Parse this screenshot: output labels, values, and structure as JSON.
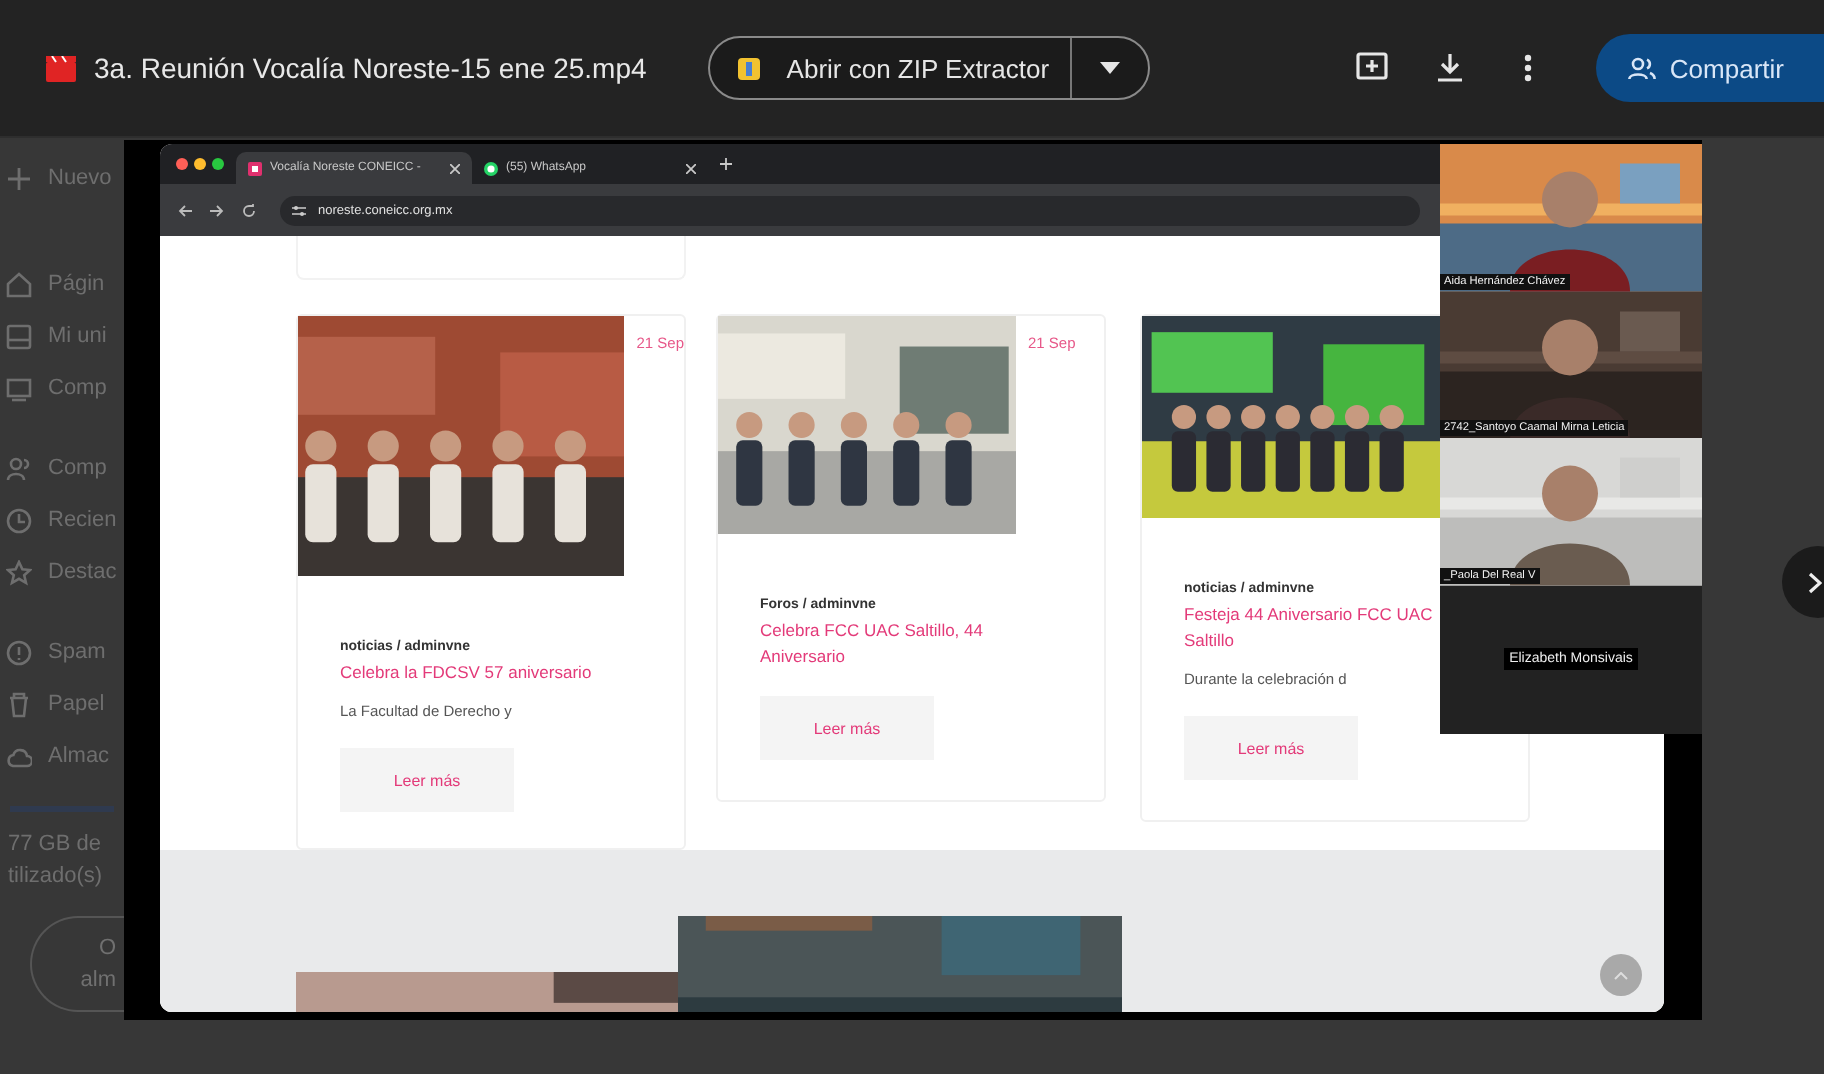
{
  "viewer": {
    "file_title": "3a. Reunión Vocalía Noreste-15 ene 25.mp4",
    "open_with": "Abrir con ZIP Extractor",
    "share": "Compartir"
  },
  "drive_sidebar": {
    "new_button": "Nuevo",
    "items": [
      {
        "label": "Págin",
        "kind": "home"
      },
      {
        "label": "Mi uni",
        "kind": "drive"
      },
      {
        "label": "Comp",
        "kind": "computer"
      },
      {
        "label": "Comp",
        "kind": "people"
      },
      {
        "label": "Recien",
        "kind": "clock"
      },
      {
        "label": "Destac",
        "kind": "star"
      },
      {
        "label": "Spam",
        "kind": "spam"
      },
      {
        "label": "Papel",
        "kind": "trash"
      },
      {
        "label": "Almac",
        "kind": "cloud"
      }
    ],
    "storage_lines": [
      "77 GB de",
      "tilizado(s)"
    ],
    "storage_button": [
      "O",
      "alm"
    ]
  },
  "video": {
    "browser": {
      "tabs": [
        {
          "title": "Vocalía Noreste CONEICC -",
          "kind": "site",
          "selected": true
        },
        {
          "title": "(55) WhatsApp",
          "kind": "chat",
          "selected": false
        }
      ],
      "url": "noreste.coneicc.org.mx",
      "posts": [
        {
          "date": "21 Sep",
          "meta": "noticias / adminvne",
          "title": "Celebra la FDCSV 57 aniversario",
          "excerpt": "La Facultad de Derecho y",
          "button": "Leer más"
        },
        {
          "date": "21 Sep",
          "meta": "Foros / adminvne",
          "title": "Celebra FCC UAC Saltillo, 44 Aniversario",
          "button": "Leer más"
        },
        {
          "meta": "noticias / adminvne",
          "title": "Festeja 44 Aniversario FCC UAC Saltillo",
          "excerpt": "Durante la celebración d",
          "button": "Leer más"
        }
      ]
    },
    "participants": [
      {
        "name": "Aida Hernández Chávez",
        "kind": "camera"
      },
      {
        "name": "2742_Santoyo Caamal Mirna Leticia",
        "kind": "camera"
      },
      {
        "name": "_Paola Del Real V",
        "kind": "camera"
      },
      {
        "name": "Elizabeth Monsivais",
        "kind": "name_only"
      }
    ]
  }
}
